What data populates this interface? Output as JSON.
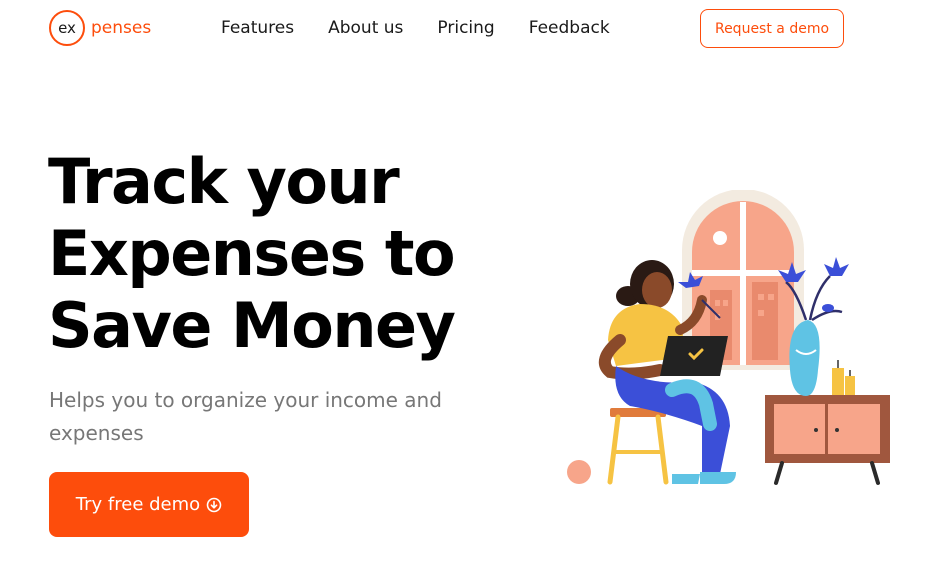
{
  "header": {
    "logo": {
      "circle_text": "ex",
      "text": "penses"
    },
    "nav": [
      {
        "label": "Features"
      },
      {
        "label": "About us"
      },
      {
        "label": "Pricing"
      },
      {
        "label": "Feedback"
      }
    ],
    "request_demo_label": "Request a demo"
  },
  "hero": {
    "title_lines": [
      "Track your",
      "Expenses to",
      "Save Money"
    ],
    "subtitle": "Helps you to organize your income and expenses",
    "cta_label": "Try free demo",
    "cta_icon": "circle-arrow-down-icon"
  },
  "colors": {
    "accent": "#fd4d0c",
    "title": "#000000",
    "subtitle": "#777777"
  },
  "illustration": {
    "name": "woman-with-laptop-illustration"
  }
}
